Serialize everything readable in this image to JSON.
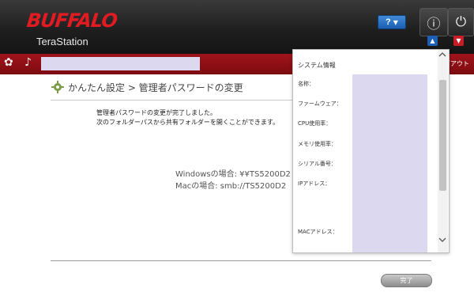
{
  "header": {
    "logo": "BUFFALO",
    "product": "TeraStation",
    "help_label": "?",
    "help_arrow": "▼",
    "info_icon": "ⓘ",
    "power_icon": "⏻",
    "up_arrow": "▲",
    "down_arrow": "▼"
  },
  "nav": {
    "settings_icon": "✿",
    "music_icon": "♪",
    "logout_label": "グアウト"
  },
  "page": {
    "breadcrumb": "かんたん設定 > 管理者パスワードの変更",
    "message_line1": "管理者パスワードの変更が完了しました。",
    "message_line2": "次のフォルダーパスから共有フォルダーを開くことができます。",
    "path_windows": "Windowsの場合: ¥¥TS5200D2",
    "path_mac": "Macの場合: smb://TS5200D2",
    "done_label": "完了"
  },
  "system_info": {
    "title": "システム情報",
    "labels": {
      "name": "名称：",
      "firmware": "ファームウェア：",
      "cpu": "CPU使用率：",
      "memory": "メモリ使用率：",
      "serial": "シリアル番号：",
      "ip": "IPアドレス：",
      "mac": "MACアドレス："
    }
  },
  "colors": {
    "brand_red": "#e01b22",
    "header_dark": "#1f1f1f",
    "nav_red": "#8c1016",
    "accent_blue": "#1c5fb4",
    "masked_field": "#dcd8f0"
  }
}
